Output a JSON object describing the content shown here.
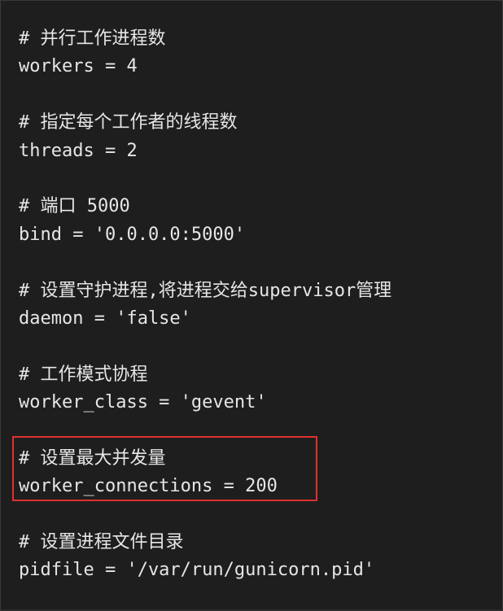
{
  "code_lines": [
    "# 并行工作进程数",
    "workers = 4",
    "",
    "# 指定每个工作者的线程数",
    "threads = 2",
    "",
    "# 端口 5000",
    "bind = '0.0.0.0:5000'",
    "",
    "# 设置守护进程,将进程交给supervisor管理",
    "daemon = 'false'",
    "",
    "# 工作模式协程",
    "worker_class = 'gevent'",
    "",
    "# 设置最大并发量",
    "worker_connections = 200",
    "",
    "# 设置进程文件目录",
    "pidfile = '/var/run/gunicorn.pid'"
  ],
  "highlight": {
    "color": "#e0302d",
    "lines": [
      15,
      16
    ]
  },
  "colors": {
    "background": "#1e1e1e",
    "text": "#e6e6e6"
  }
}
